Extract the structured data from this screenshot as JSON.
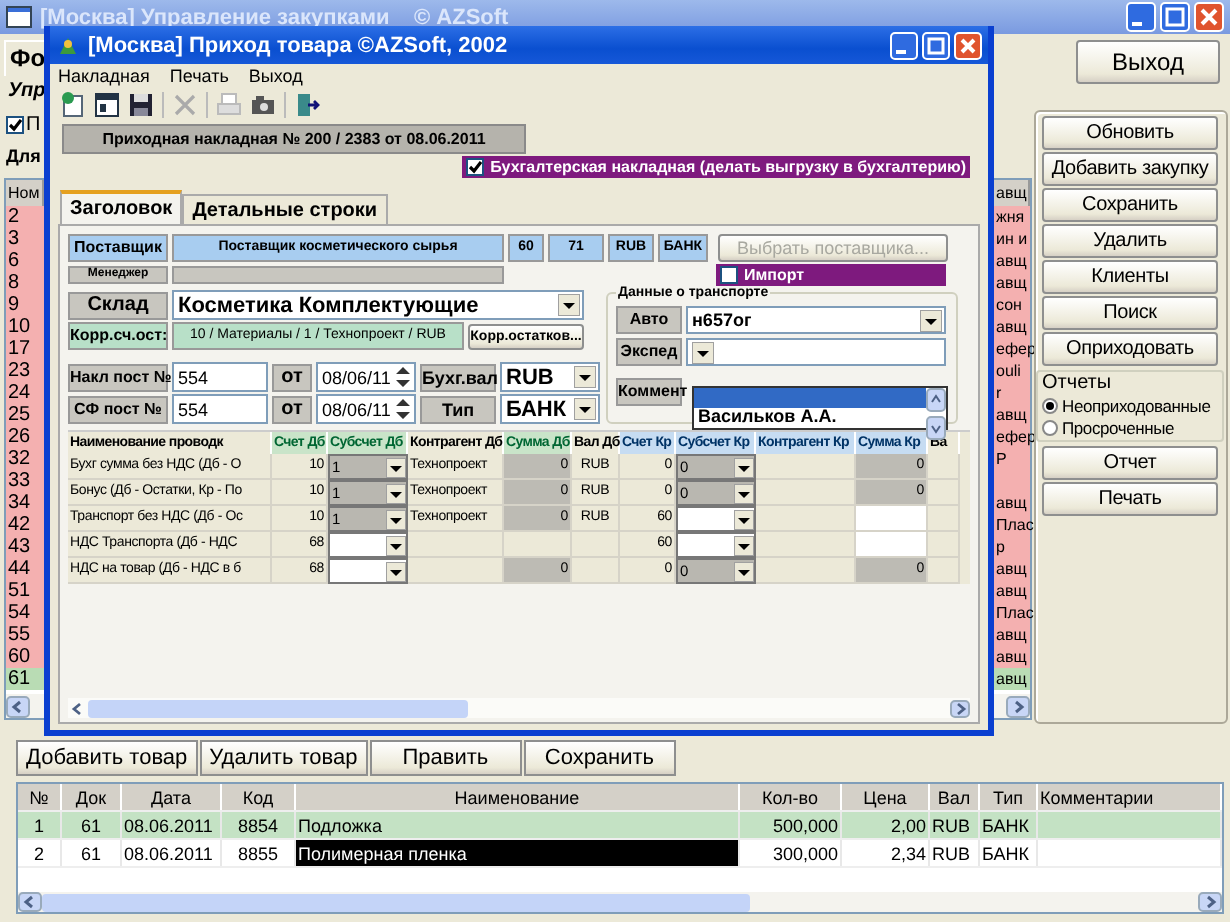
{
  "main_window": {
    "title": "[Москва] Управление закупками    © AZSoft"
  },
  "background": {
    "form_tab": "Фо",
    "section_title": "Упр",
    "checkbox": {
      "label": "П",
      "checked": true
    },
    "list_title": "Для",
    "list": {
      "columns": [
        "Ном",
        "авщ"
      ],
      "rows": [
        {
          "number": "2",
          "column_2": "жня",
          "color": "#f4b0b0"
        },
        {
          "number": "3",
          "column_2": "ин и",
          "color": "#f4b0b0"
        },
        {
          "number": "6",
          "column_2": "авщ",
          "color": "#f4b0b0"
        },
        {
          "number": "8",
          "column_2": "авщ",
          "color": "#f4b0b0"
        },
        {
          "number": "9",
          "column_2": "сон",
          "color": "#f4b0b0"
        },
        {
          "number": "10",
          "column_2": "авщ",
          "color": "#f4b0b0"
        },
        {
          "number": "17",
          "column_2": "ефер",
          "color": "#f4b0b0"
        },
        {
          "number": "23",
          "column_2": "ouli",
          "color": "#f4b0b0"
        },
        {
          "number": "24",
          "column_2": "r",
          "color": "#f4b0b0"
        },
        {
          "number": "25",
          "column_2": "авщ",
          "color": "#f4b0b0"
        },
        {
          "number": "26",
          "column_2": "ефер",
          "color": "#f4b0b0"
        },
        {
          "number": "32",
          "column_2": "P",
          "color": "#f4b0b0"
        },
        {
          "number": "33",
          "color": "#f4b0b0"
        },
        {
          "number": "34",
          "column_2": "авщ",
          "color": "#f4b0b0"
        },
        {
          "number": "42",
          "column_2": "Плас",
          "color": "#f4b0b0"
        },
        {
          "number": "43",
          "column_2": "р",
          "color": "#f4b0b0"
        },
        {
          "number": "44",
          "column_2": "авщ",
          "color": "#f4b0b0"
        },
        {
          "number": "51",
          "column_2": "авщ",
          "color": "#f4b0b0"
        },
        {
          "number": "54",
          "column_2": "Плас",
          "color": "#f4b0b0"
        },
        {
          "number": "55",
          "column_2": "авщ",
          "color": "#f4b0b0"
        },
        {
          "number": "60",
          "column_2": "авщ",
          "color": "#f4b0b0"
        },
        {
          "number": "61",
          "column_2": "авщ",
          "color": "#b9dcb4"
        }
      ]
    }
  },
  "exit_button": "Выход",
  "actions": [
    "Обновить",
    "Добавить закупку",
    "Сохранить",
    "Удалить",
    "Клиенты",
    "Поиск",
    "Оприходовать"
  ],
  "reports": {
    "title": "Отчеты",
    "options": [
      {
        "label": "Неоприходованные",
        "selected": true
      },
      {
        "label": "Просроченные",
        "selected": false
      }
    ]
  },
  "report_buttons": [
    "Отчет",
    "Печать"
  ],
  "dialog": {
    "title": "[Москва] Приход товара ©AZSoft, 2002",
    "menu": [
      "Накладная",
      "Печать",
      "Выход"
    ],
    "heading": "Приходная накладная № 200 / 2383 от 08.06.2011",
    "accounting_checkbox": {
      "label": "Бухгалтерская накладная (делать выгрузку в бухгалтерию)",
      "checked": true
    },
    "tabs": [
      {
        "label": "Заголовок",
        "selected": true
      },
      {
        "label": "Детальные строки",
        "selected": false
      }
    ],
    "supplier": {
      "label": "Поставщик",
      "name": "Поставщик косметического сырья",
      "codes": [
        "60",
        "71",
        "RUB",
        "БАНК"
      ],
      "manager_label": "Менеджер"
    },
    "choose_supplier_button": {
      "label": "Выбрать поставщика...",
      "disabled": true
    },
    "import_checkbox": {
      "label": "Импорт",
      "checked": false
    },
    "warehouse": {
      "label": "Склад",
      "value": "Косметика Комплектующие"
    },
    "corr_account": {
      "label": "Корр.сч.ост:",
      "value": "10 / Материалы / 1 / Технопроект / RUB",
      "button": "Корр.остатков..."
    },
    "invoices": [
      {
        "label": "Накл пост №",
        "number": "554",
        "from": "от",
        "date": "08/06/11",
        "extra_label": "Бухг.вал",
        "extra_value": "RUB"
      },
      {
        "label": "СФ пост №",
        "number": "554",
        "from": "от",
        "date": "08/06/11",
        "extra_label": "Тип",
        "extra_value": "БАНК"
      }
    ],
    "transport": {
      "title": "Данные о транспорте",
      "car_label": "Авто",
      "car": "н657ог",
      "forwarder_label": "Экспед",
      "comment_label": "Коммент",
      "dropdown_options": [
        {
          "selected": true
        },
        {
          "label": "Васильков А.А.",
          "selected": false
        }
      ]
    },
    "postings": {
      "columns": [
        {
          "label": "Наименование проводк",
          "kind": "plain"
        },
        {
          "label": "Счет Дб",
          "kind": "debit"
        },
        {
          "label": "Субсчет Дб",
          "kind": "debit"
        },
        {
          "label": "Контрагент Дб",
          "kind": "plain"
        },
        {
          "label": "Сумма Дб",
          "kind": "debit"
        },
        {
          "label": "Вал Дб",
          "kind": "plain"
        },
        {
          "label": "Счет Кр",
          "kind": "credit"
        },
        {
          "label": "Субсчет Кр",
          "kind": "credit"
        },
        {
          "label": "Контрагент Кр",
          "kind": "credit"
        },
        {
          "label": "Сумма Кр",
          "kind": "credit"
        },
        {
          "label": "Ва",
          "kind": "plain"
        }
      ],
      "rows": [
        {
          "cells": [
            {
              "kind": "text",
              "value": "Бухг сумма без НДС (Дб - О"
            },
            {
              "kind": "number",
              "value": "10"
            },
            {
              "kind": "combo",
              "value": "1",
              "disabled": true
            },
            {
              "kind": "text",
              "value": "Технопроект"
            },
            {
              "kind": "sum",
              "value": "0",
              "disabled": true
            },
            {
              "kind": "currency",
              "value": "RUB"
            },
            {
              "kind": "number",
              "value": "0"
            },
            {
              "kind": "combo",
              "value": "0",
              "disabled": true
            },
            {
              "kind": "blank"
            },
            {
              "kind": "sum",
              "value": "0",
              "disabled": true
            },
            {
              "kind": "blank"
            }
          ]
        },
        {
          "cells": [
            {
              "kind": "text",
              "value": "Бонус (Дб - Остатки, Кр - По"
            },
            {
              "kind": "number",
              "value": "10"
            },
            {
              "kind": "combo",
              "value": "1",
              "disabled": true
            },
            {
              "kind": "text",
              "value": "Технопроект"
            },
            {
              "kind": "sum",
              "value": "0",
              "disabled": true
            },
            {
              "kind": "currency",
              "value": "RUB"
            },
            {
              "kind": "number",
              "value": "0"
            },
            {
              "kind": "combo",
              "value": "0",
              "disabled": true
            },
            {
              "kind": "blank"
            },
            {
              "kind": "sum",
              "value": "0",
              "disabled": true
            },
            {
              "kind": "blank"
            }
          ]
        },
        {
          "cells": [
            {
              "kind": "text",
              "value": "Транспорт без НДС (Дб - Ос"
            },
            {
              "kind": "number",
              "value": "10"
            },
            {
              "kind": "combo",
              "value": "1",
              "disabled": true
            },
            {
              "kind": "text",
              "value": "Технопроект"
            },
            {
              "kind": "sum",
              "value": "0",
              "disabled": true
            },
            {
              "kind": "currency",
              "value": "RUB"
            },
            {
              "kind": "number",
              "value": "60"
            },
            {
              "kind": "combo",
              "disabled": false
            },
            {
              "kind": "blank"
            },
            {
              "kind": "sum",
              "disabled": false
            },
            {
              "kind": "blank"
            }
          ]
        },
        {
          "cells": [
            {
              "kind": "text",
              "value": "НДС Транспорта (Дб - НДС"
            },
            {
              "kind": "number",
              "value": "68"
            },
            {
              "kind": "combo",
              "disabled": false
            },
            {
              "kind": "blank"
            },
            {
              "kind": "blank"
            },
            {
              "kind": "blank"
            },
            {
              "kind": "number",
              "value": "60"
            },
            {
              "kind": "combo",
              "disabled": false
            },
            {
              "kind": "blank"
            },
            {
              "kind": "sum",
              "disabled": false
            },
            {
              "kind": "blank"
            }
          ]
        },
        {
          "cells": [
            {
              "kind": "text",
              "value": "НДС на товар (Дб - НДС в б"
            },
            {
              "kind": "number",
              "value": "68"
            },
            {
              "kind": "combo",
              "disabled": false
            },
            {
              "kind": "blank"
            },
            {
              "kind": "sum",
              "value": "0",
              "disabled": true
            },
            {
              "kind": "blank"
            },
            {
              "kind": "number",
              "value": "0"
            },
            {
              "kind": "combo",
              "value": "0",
              "disabled": true
            },
            {
              "kind": "blank"
            },
            {
              "kind": "sum",
              "value": "0",
              "disabled": true
            },
            {
              "kind": "blank"
            }
          ]
        }
      ]
    }
  },
  "items": {
    "buttons": [
      "Добавить товар",
      "Удалить товар",
      "Править",
      "Сохранить"
    ],
    "table": {
      "columns": [
        "№",
        "Док",
        "Дата",
        "Код",
        "Наименование",
        "Кол-во",
        "Цена",
        "Вал",
        "Тип",
        "Комментарии"
      ],
      "rows": [
        {
          "cells": [
            "1",
            "61",
            "08.06.2011",
            "8854",
            "Подложка",
            "500,000",
            "2,00",
            "RUB",
            "БАНК"
          ],
          "selected": true,
          "name_focused": false
        },
        {
          "cells": [
            "2",
            "61",
            "08.06.2011",
            "8855",
            "Полимерная пленка",
            "300,000",
            "2,34",
            "RUB",
            "БАНК"
          ],
          "selected": false,
          "name_focused": true
        }
      ]
    }
  }
}
